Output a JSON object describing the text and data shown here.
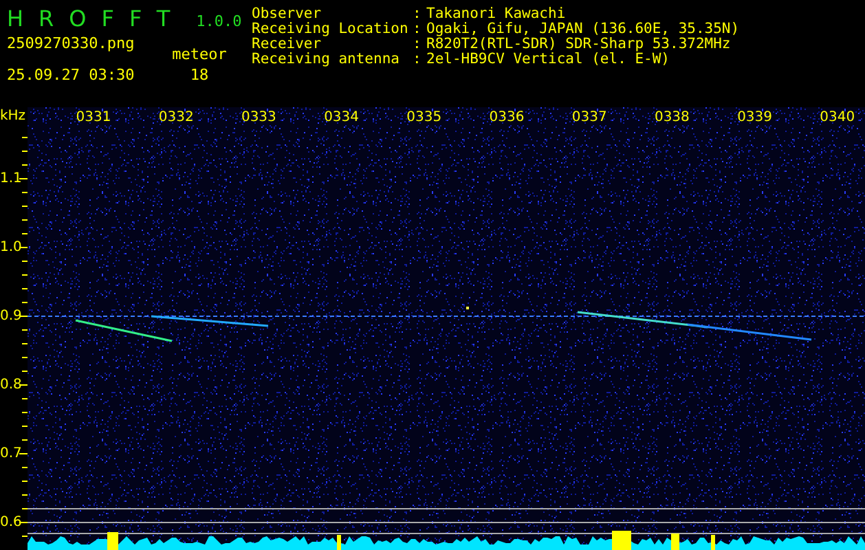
{
  "app": {
    "title": "HROFFT",
    "version": "1.0.0"
  },
  "file": {
    "name": "2509270330.png",
    "datetime": "25.09.27 03:30"
  },
  "meteor": {
    "label": "meteor",
    "count": "18"
  },
  "info": [
    {
      "label": "Observer",
      "value": "Takanori Kawachi"
    },
    {
      "label": "Receiving Location",
      "value": "Ogaki, Gifu, JAPAN (136.60E, 35.35N)"
    },
    {
      "label": "Receiver",
      "value": "R820T2(RTL-SDR) SDR-Sharp 53.372MHz"
    },
    {
      "label": "Receiving antenna",
      "value": "2el-HB9CV Vertical (el. E-W)"
    }
  ],
  "separator": ":",
  "axis_unit": "kHz",
  "time_labels": [
    "0331",
    "0332",
    "0333",
    "0334",
    "0335",
    "0336",
    "0337",
    "0338",
    "0339",
    "0340"
  ],
  "freq_labels": [
    "1.1",
    "1.0",
    "0.9",
    "0.8",
    "0.7",
    "0.6"
  ]
}
